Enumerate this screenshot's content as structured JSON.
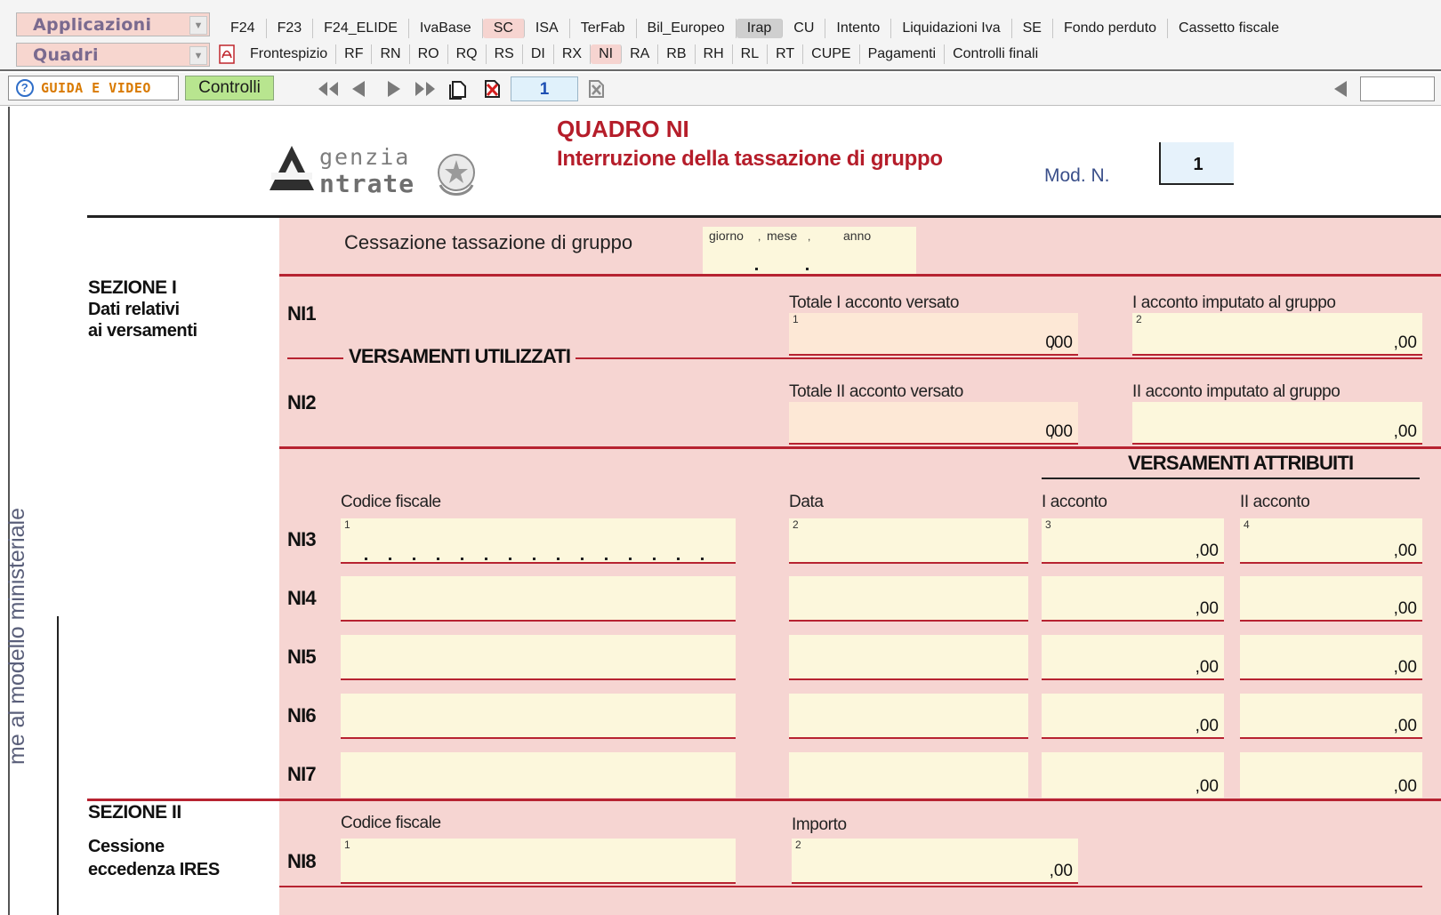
{
  "toolbar": {
    "applicazioni": "Applicazioni",
    "quadri": "Quadri",
    "tabs1": [
      "F24",
      "F23",
      "F24_ELIDE",
      "IvaBase",
      "SC",
      "ISA",
      "TerFab",
      "Bil_Europeo",
      "Irap",
      "CU",
      "Intento",
      "Liquidazioni Iva",
      "SE",
      "Fondo perduto",
      "Cassetto fiscale"
    ],
    "tabs2": [
      "Frontespizio",
      "RF",
      "RN",
      "RO",
      "RQ",
      "RS",
      "DI",
      "RX",
      "NI",
      "RA",
      "RB",
      "RH",
      "RL",
      "RT",
      "CUPE",
      "Pagamenti",
      "Controlli finali"
    ],
    "guida": "GUIDA E VIDEO",
    "controlli": "Controlli",
    "page_index": "1",
    "search_value": ""
  },
  "form": {
    "side_text": "me al modello ministeriale",
    "logo_genzia": "genzia",
    "logo_ntrate": "ntrate",
    "title": "QUADRO NI",
    "subtitle": "Interruzione della tassazione di gruppo",
    "modn_label": "Mod. N.",
    "modn_value": "1",
    "cessazione_label": "Cessazione tassazione di gruppo",
    "date_giorno": "giorno",
    "date_mese": "mese",
    "date_anno": "anno",
    "sez1_title": "SEZIONE I",
    "sez1_sub1": "Dati relativi",
    "sez1_sub2": "ai versamenti",
    "sez2_title": "SEZIONE II",
    "sez2_sub1": "Cessione",
    "sez2_sub2": "eccedenza IRES",
    "ni1": "NI1",
    "ni2": "NI2",
    "ni3": "NI3",
    "ni4": "NI4",
    "ni5": "NI5",
    "ni6": "NI6",
    "ni7": "NI7",
    "ni8": "NI8",
    "tot_i_acconto": "Totale I acconto versato",
    "i_acconto_gruppo": "I acconto imputato al gruppo",
    "tot_ii_acconto": "Totale II acconto versato",
    "ii_acconto_gruppo": "II acconto imputato al gruppo",
    "versamenti_utilizzati": "VERSAMENTI UTILIZZATI",
    "versamenti_attribuiti": "VERSAMENTI ATTRIBUITI",
    "codice_fiscale": "Codice fiscale",
    "data": "Data",
    "i_acconto": "I acconto",
    "ii_acconto": "II acconto",
    "importo": "Importo",
    "ni1_val": "0",
    "ni2_val": "0",
    "cents": ",00",
    "num1": "1",
    "num2": "2",
    "num3": "3",
    "num4": "4"
  }
}
